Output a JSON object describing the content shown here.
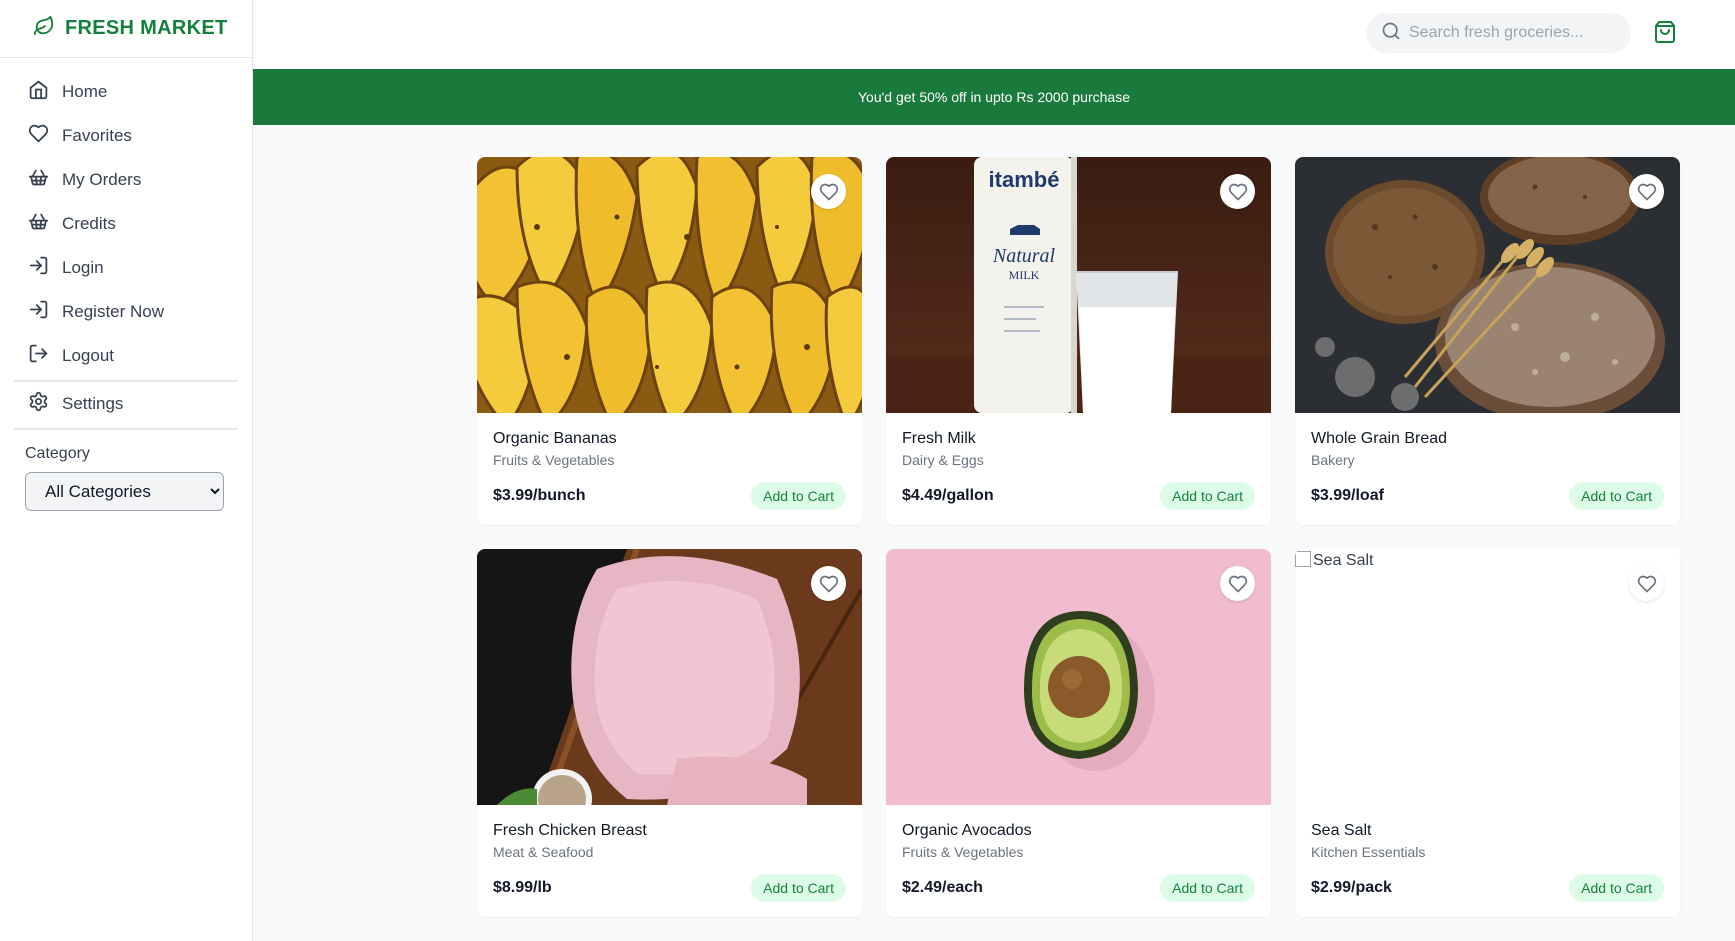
{
  "brand": {
    "name": "FRESH MARKET",
    "icon": "leaf-icon",
    "color": "#15803d"
  },
  "sidebar": {
    "items": [
      {
        "label": "Home",
        "icon": "home-icon"
      },
      {
        "label": "Favorites",
        "icon": "heart-icon"
      },
      {
        "label": "My Orders",
        "icon": "basket-icon"
      },
      {
        "label": "Credits",
        "icon": "basket-icon"
      },
      {
        "label": "Login",
        "icon": "login-icon"
      },
      {
        "label": "Register Now",
        "icon": "login-icon"
      },
      {
        "label": "Logout",
        "icon": "logout-icon"
      }
    ],
    "settings_label": "Settings",
    "category_label": "Category",
    "category_selected": "All Categories"
  },
  "header": {
    "search_placeholder": "Search fresh groceries...",
    "cart_icon": "shopping-bag-icon"
  },
  "banner": {
    "text": "You'd get 50% off in upto Rs 2000 purchase",
    "color": "#1a7a3c"
  },
  "products": [
    {
      "name": "Organic Bananas",
      "category": "Fruits & Vegetables",
      "price": "$3.99/bunch",
      "add_label": "Add to Cart"
    },
    {
      "name": "Fresh Milk",
      "category": "Dairy & Eggs",
      "price": "$4.49/gallon",
      "add_label": "Add to Cart"
    },
    {
      "name": "Whole Grain Bread",
      "category": "Bakery",
      "price": "$3.99/loaf",
      "add_label": "Add to Cart"
    },
    {
      "name": "Fresh Chicken Breast",
      "category": "Meat & Seafood",
      "price": "$8.99/lb",
      "add_label": "Add to Cart"
    },
    {
      "name": "Organic Avocados",
      "category": "Fruits & Vegetables",
      "price": "$2.49/each",
      "add_label": "Add to Cart"
    },
    {
      "name": "Sea Salt",
      "category": "Kitchen Essentials",
      "price": "$2.99/pack",
      "add_label": "Add to Cart",
      "image_alt": "Sea Salt"
    }
  ],
  "milk_carton": {
    "brand": "itambé",
    "line1": "Natural",
    "line2": "MILK"
  },
  "colors": {
    "accent": "#15803d",
    "button_bg": "#dcfce7"
  }
}
